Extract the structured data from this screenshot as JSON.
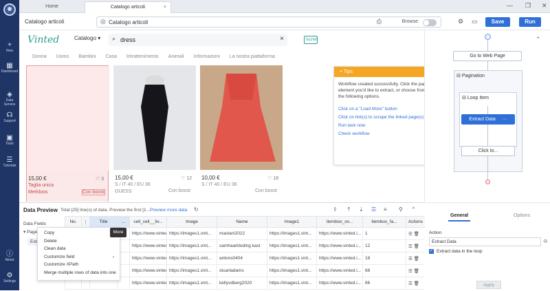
{
  "sidebar": {
    "items": [
      {
        "icon": "plus-icon",
        "label": "New"
      },
      {
        "icon": "dashboard-icon",
        "label": "Dashboard"
      },
      {
        "icon": "data-service-icon",
        "label": "Data Service"
      },
      {
        "icon": "headset-icon",
        "label": "Support"
      },
      {
        "icon": "tools-icon",
        "label": "Tools"
      },
      {
        "icon": "tutorials-icon",
        "label": "Tutorials"
      },
      {
        "icon": "about-icon",
        "label": "About"
      },
      {
        "icon": "settings-icon",
        "label": "Settings"
      }
    ]
  },
  "tabs": [
    {
      "label": "Home"
    },
    {
      "label": "Catalogo articoli"
    }
  ],
  "toolbar": {
    "page_title": "Catalogo articoli",
    "url": "Catalogo articoli",
    "browse_label": "Browse",
    "save_label": "Save",
    "run_label": "Run"
  },
  "site": {
    "logo": "Vinted",
    "category": "Catalogo",
    "query": "dress",
    "side_button": "Iscriviti",
    "nav": [
      "Donna",
      "Uomo",
      "Bambini",
      "Casa",
      "Intrattenimento",
      "Animali",
      "Informazioni",
      "La nostra piattaforma"
    ],
    "cards": [
      {
        "price": "15,00 €",
        "size": "Taglia unica",
        "brand": "Merkloos",
        "boost": "Con boost",
        "fav": "3"
      },
      {
        "price": "15,00 €",
        "size": "S / IT 40 / EU 36",
        "brand": "GUESS",
        "boost": "Con boost",
        "fav": "12"
      },
      {
        "price": "10,00 €",
        "size": "S / IT 40 / EU 36",
        "brand": "",
        "boost": "Con boost",
        "fav": "18"
      }
    ]
  },
  "tips": {
    "title": "Tips",
    "message": "Workflow created successfully. Click the page element you'd like to extract, or choose from the following options.",
    "links": [
      "Click on a \"Load More\" button",
      "Click on link(s) to scrape the linked page(s)",
      "Run task now",
      "Check workflow"
    ]
  },
  "data_preview": {
    "title": "Data Preview",
    "info": "Total [25] line(s) of data. Preview the first [1...",
    "more_link": "Preview more data",
    "fields_label": "Data Fields",
    "tree_item": "Page",
    "tree_sub": "Extr...",
    "columns": [
      "No.",
      "",
      "Title",
      "...",
      "cell_cell__3v...",
      "Image",
      "Name",
      "Image1",
      "itembox_ov...",
      "itembox_fa...",
      "Actions"
    ],
    "rows": [
      [
        "https://www.vinted.i...",
        "https://images1.vint...",
        "mastani2022",
        "https://images1.vint...",
        "https://www.vinted.i...",
        "1"
      ],
      [
        "https://www.vinted.i...",
        "https://images1.vint...",
        "samhaarkleding kast",
        "https://images1.vint...",
        "https://www.vinted.i...",
        "12"
      ],
      [
        "https://www.vinted.i...",
        "https://images1.vint...",
        "antons0404",
        "https://images1.vint...",
        "https://www.vinted.i...",
        "18"
      ],
      [
        "https://www.vinted.i...",
        "https://images1.vint...",
        "stuartadams",
        "https://images1.vint...",
        "https://www.vinted.i...",
        "68"
      ],
      [
        "https://www.vinted.i...",
        "https://images1.vint...",
        "kellyvdberg2020",
        "https://images1.vint...",
        "https://www.vinted.i...",
        "86"
      ]
    ]
  },
  "context_menu": {
    "items": [
      "Copy",
      "Delete",
      "Clean data",
      "Customize field",
      "Customize XPath",
      "Merge multiple rows of data into one"
    ],
    "tooltip": "More"
  },
  "workflow": {
    "goto": "Go to Web Page",
    "pagination": "Pagination",
    "loop": "Loop Item",
    "extract": "Extract Data",
    "click": "Click to..."
  },
  "properties": {
    "tab_general": "General",
    "tab_options": "Options",
    "action_label": "Action",
    "action_value": "Extract Data",
    "checkbox_label": "Extract data in the loop",
    "apply": "Apply"
  },
  "colors": {
    "sidebar": "#1f3566",
    "accent": "#2f6fd8",
    "tips_header": "#f5a623",
    "vinted": "#2a9d8f",
    "dress_black": "#15151a",
    "dress_coral": "#e2574c"
  }
}
